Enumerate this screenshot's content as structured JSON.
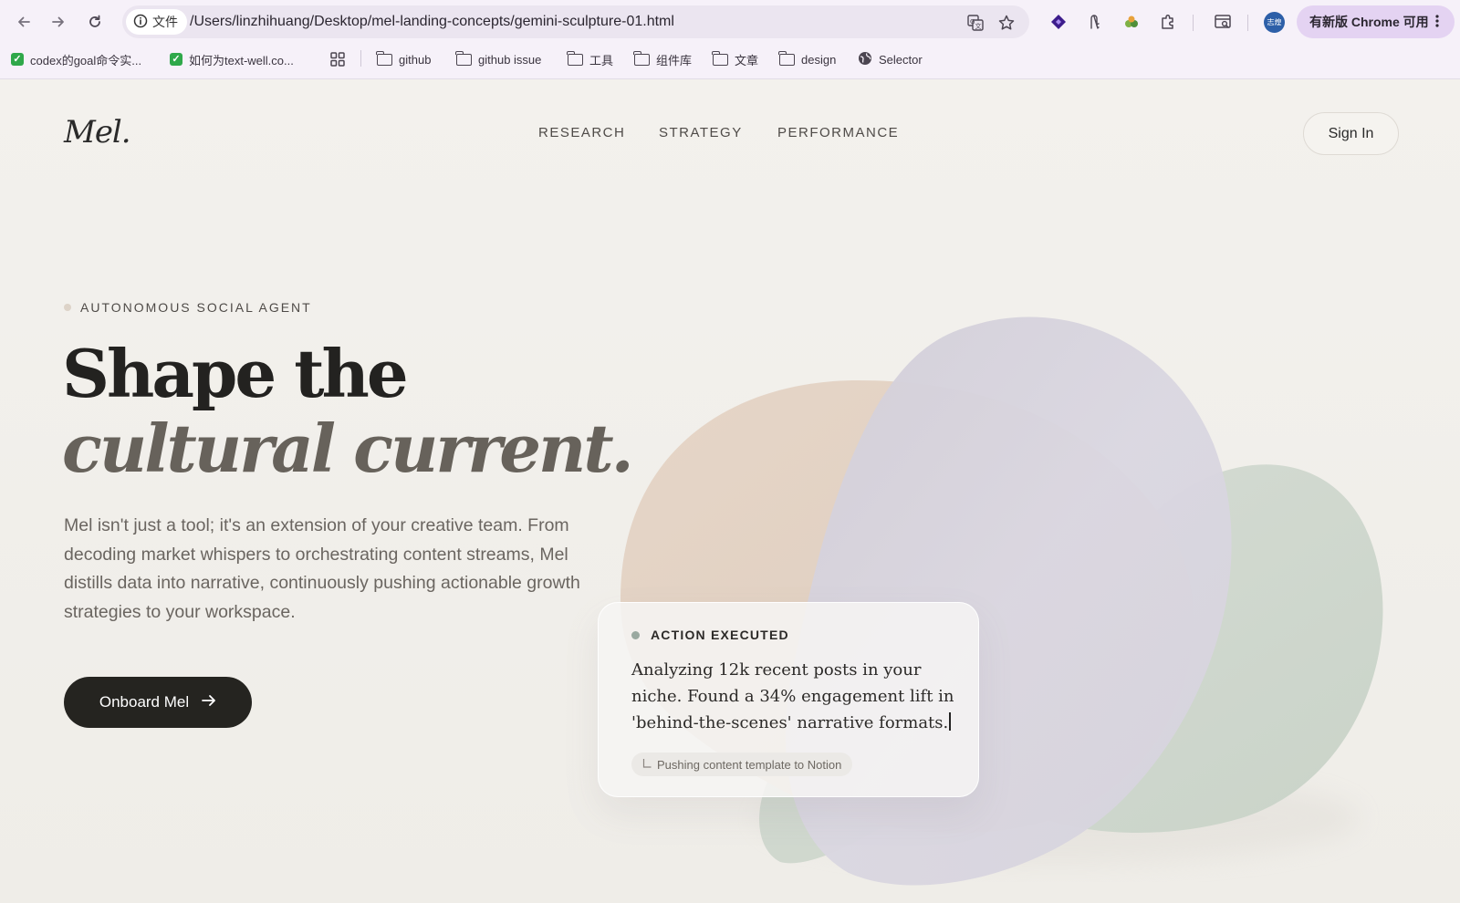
{
  "browser": {
    "site_label": "文件",
    "url": "/Users/linzhihuang/Desktop/mel-landing-concepts/gemini-sculpture-01.html",
    "update_label": "有新版 Chrome 可用",
    "avatar_text": "志煌",
    "bookmarks": [
      {
        "label": "codex的goal命令实...",
        "type": "check"
      },
      {
        "label": "如何为text-well.co...",
        "type": "check"
      },
      {
        "label": "github",
        "type": "folder"
      },
      {
        "label": "github issue",
        "type": "folder"
      },
      {
        "label": "工具",
        "type": "folder"
      },
      {
        "label": "组件库",
        "type": "folder"
      },
      {
        "label": "文章",
        "type": "folder"
      },
      {
        "label": "design",
        "type": "folder"
      },
      {
        "label": "Selector",
        "type": "globe"
      }
    ]
  },
  "site": {
    "logo": "Mel.",
    "nav": [
      "RESEARCH",
      "STRATEGY",
      "PERFORMANCE"
    ],
    "signin": "Sign In"
  },
  "hero": {
    "eyebrow": "AUTONOMOUS SOCIAL AGENT",
    "headline_line1": "Shape the",
    "headline_line2": "cultural current.",
    "lede": "Mel isn't just a tool; it's an extension of your creative team. From decoding market whispers to orchestrating content streams, Mel distills data into narrative, continuously pushing actionable growth strategies to your workspace.",
    "cta": "Onboard Mel"
  },
  "card": {
    "status": "ACTION EXECUTED",
    "message": "Analyzing 12k recent posts in your niche. Found a 34% engagement lift in 'behind-the-scenes' narrative formats.",
    "chip": "Pushing content template to Notion"
  },
  "colors": {
    "page_bg": "#f2f0ec",
    "cta_bg": "#252420",
    "blob_peach": "#e3d3c5",
    "blob_lavender": "#d6d3de",
    "blob_sage": "#cfd8cf",
    "chrome_bg": "#f6f1f9",
    "update_bg": "#e4d3f2"
  }
}
